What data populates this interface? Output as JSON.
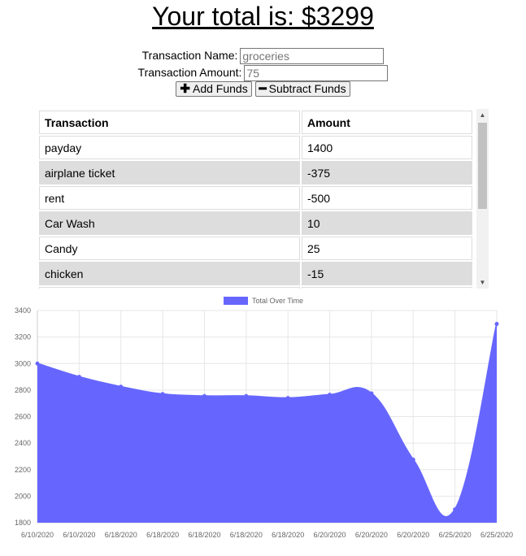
{
  "header": {
    "total_label": "Your total is: $3299"
  },
  "form": {
    "name_label": "Transaction Name:",
    "name_placeholder": "groceries",
    "amount_label": "Transaction Amount:",
    "amount_placeholder": "75",
    "add_label": "Add Funds",
    "subtract_label": "Subtract Funds",
    "add_icon": "plus-icon",
    "subtract_icon": "minus-icon"
  },
  "table": {
    "headers": [
      "Transaction",
      "Amount"
    ],
    "rows": [
      [
        "payday",
        "1400"
      ],
      [
        "airplane ticket",
        "-375"
      ],
      [
        "rent",
        "-500"
      ],
      [
        "Car Wash",
        "10"
      ],
      [
        "Candy",
        "25"
      ],
      [
        "chicken",
        "-15"
      ]
    ]
  },
  "colors": {
    "accent": "#6666ff",
    "row_alt": "#dddddd"
  },
  "chart_data": {
    "type": "area",
    "legend": "Total Over Time",
    "legend_position": "top",
    "grid": true,
    "ylim": [
      1800,
      3400
    ],
    "yticks": [
      1800,
      2000,
      2200,
      2400,
      2600,
      2800,
      3000,
      3200,
      3400
    ],
    "x": [
      "6/10/2020",
      "6/10/2020",
      "6/18/2020",
      "6/18/2020",
      "6/18/2020",
      "6/18/2020",
      "6/18/2020",
      "6/20/2020",
      "6/20/2020",
      "6/20/2020",
      "6/25/2020",
      "6/25/2020"
    ],
    "series": [
      {
        "name": "Total Over Time",
        "values": [
          3000,
          2900,
          2825,
          2770,
          2755,
          2755,
          2740,
          2765,
          2775,
          2275,
          1900,
          3299
        ]
      }
    ]
  }
}
